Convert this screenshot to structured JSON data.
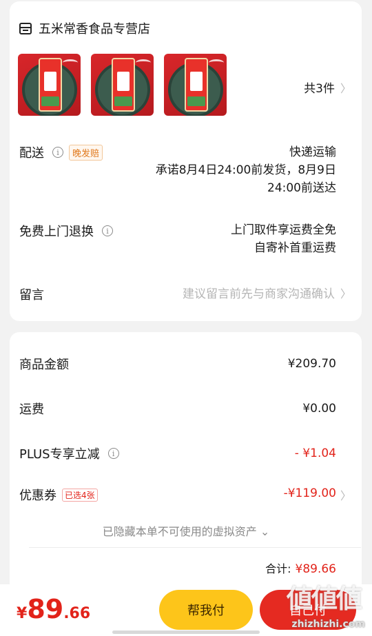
{
  "shop": {
    "name": "五米常香食品专营店",
    "icon": "store-icon"
  },
  "items": {
    "count_label": "共3件",
    "thumb_count": 3
  },
  "delivery": {
    "label": "配送",
    "tag": "晚发赔",
    "method": "快递运输",
    "promise_line1": "承诺8月4日24:00前发货，8月9日",
    "promise_line2": "24:00前送达"
  },
  "returns": {
    "label": "免费上门退换",
    "line1": "上门取件享运费全免",
    "line2": "自寄补首重运费"
  },
  "note": {
    "label": "留言",
    "placeholder": "建议留言前先与商家沟通确认"
  },
  "summary": {
    "goods_label": "商品金额",
    "goods_value": "¥209.70",
    "shipping_label": "运费",
    "shipping_value": "¥0.00",
    "plus_label": "PLUS专享立减",
    "plus_value": "- ¥1.04",
    "coupon_label": "优惠券",
    "coupon_tag": "已选4张",
    "coupon_value": "-¥119.00",
    "hidden_note": "已隐藏本单不可使用的虚拟资产 ⌄",
    "total_label": "合计:",
    "total_value": "¥89.66"
  },
  "bottom": {
    "yen": "¥",
    "price_int": "89",
    "price_dec": ".66",
    "help_pay": "帮我付",
    "pay_self": "自己付"
  },
  "watermark": {
    "glyphs": "値値値",
    "url": "zhizhizhi.com"
  },
  "colors": {
    "accent_red": "#e2231a",
    "help_yellow": "#fdc51a",
    "pay_red": "#e52a21",
    "tag_orange": "#e07a1f"
  }
}
